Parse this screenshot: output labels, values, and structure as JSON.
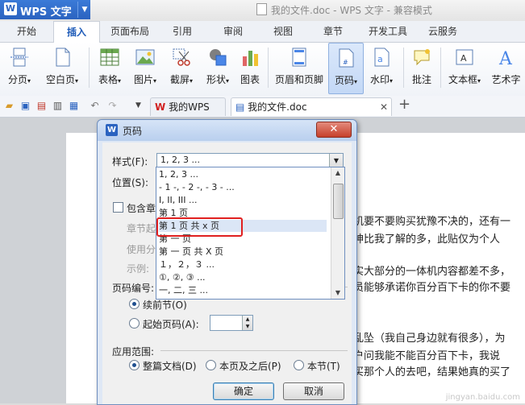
{
  "app": {
    "name": "WPS 文字",
    "window_title": "我的文件.doc - WPS 文字 - 兼容模式"
  },
  "ribbon_tabs": [
    "开始",
    "插入",
    "页面布局",
    "引用",
    "审阅",
    "视图",
    "章节",
    "开发工具",
    "云服务"
  ],
  "active_tab": "插入",
  "ribbon": {
    "page_break": "分页",
    "blank_page": "空白页",
    "table": "表格",
    "picture": "图片",
    "screenshot": "截屏",
    "shape": "形状",
    "chart": "图表",
    "header_footer": "页眉和页脚",
    "page_number": "页码",
    "watermark": "水印",
    "comment": "批注",
    "textbox": "文本框",
    "art_text": "艺术字"
  },
  "doc_tabs": [
    {
      "label": "我的WPS"
    },
    {
      "label": "我的文件.doc"
    }
  ],
  "document_text": {
    "line1": "体机要不要购买犹豫不决的，还有一",
    "line2": "大神比我了解的多，此贴仅为个人",
    "line3": "其实大部分的一体机内容都差不多，",
    "line4": "人员能够承诺你百分百下卡的你不要",
    "line5": "死乱坠（我自己身边就有很多），为",
    "line6": "客户问我能不能百分百下卡，我说",
    "line7": "你买那个人的去吧，结果她真的买了"
  },
  "watermark": "jingyan.baidu.com",
  "dialog": {
    "title": "页码",
    "style_label": "样式(F):",
    "style_value": "1, 2, 3 ...",
    "position_label": "位置(S):",
    "include_chapter_label": "包含章",
    "chapter_start_label": "章节起",
    "use_sep_label": "使用分",
    "example_label": "示例:",
    "numbering_label": "页码编号:",
    "continue_label": "续前节(O)",
    "start_label": "起始页码(A):",
    "start_value": "",
    "apply_label": "应用范围:",
    "apply_options": [
      "整篇文档(D)",
      "本页及之后(P)",
      "本节(T)"
    ],
    "ok": "确定",
    "cancel": "取消",
    "style_options": [
      "1, 2, 3 ...",
      "- 1 -, - 2 -, - 3 - ...",
      "I, II, III ...",
      "第 1 页",
      "第 1 页 共 x 页",
      "第 一 页",
      "第 一 页 共 X 页",
      "１，２，３ ...",
      "①, ②, ③ ...",
      "一, 二, 三 ..."
    ]
  }
}
